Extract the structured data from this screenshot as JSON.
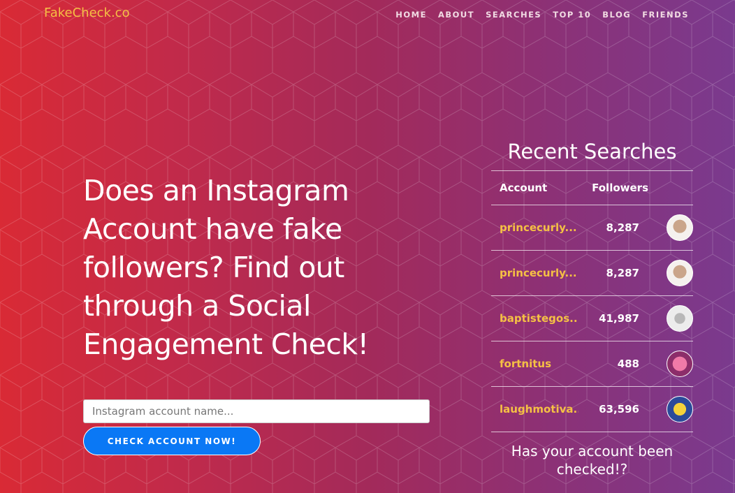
{
  "brand": "FakeCheck.co",
  "nav": [
    "HOME",
    "ABOUT",
    "SEARCHES",
    "TOP 10",
    "BLOG",
    "FRIENDS"
  ],
  "hero": {
    "headline": "Does an Instagram Account have fake followers? Find out through a Social Engagement Check!"
  },
  "search": {
    "placeholder": "Instagram account name...",
    "value": ""
  },
  "cta_button": "CHECK ACCOUNT NOW!",
  "recent": {
    "title": "Recent Searches",
    "headers": {
      "account": "Account",
      "followers": "Followers"
    },
    "rows": [
      {
        "account": "princecurly...",
        "followers": "8,287",
        "avatar": "sunglasses-avatar",
        "color": "#e9d7c9"
      },
      {
        "account": "princecurly...",
        "followers": "8,287",
        "avatar": "sunglasses-avatar",
        "color": "#e9d7c9"
      },
      {
        "account": "baptistegos...",
        "followers": "41,987",
        "avatar": "drawn-face-avatar",
        "color": "#d9d9d9"
      },
      {
        "account": "fortnitus",
        "followers": "488",
        "avatar": "pink-bear-avatar",
        "color": "#e44a8a"
      },
      {
        "account": "laughmotiva...",
        "followers": "63,596",
        "avatar": "cartoon-avatar",
        "color": "#f4d23a"
      }
    ],
    "footer_text": "Has your account been checked!?"
  },
  "colors": {
    "brand": "#f5c044",
    "button": "#0a78f5",
    "account_link": "#f5c044"
  }
}
